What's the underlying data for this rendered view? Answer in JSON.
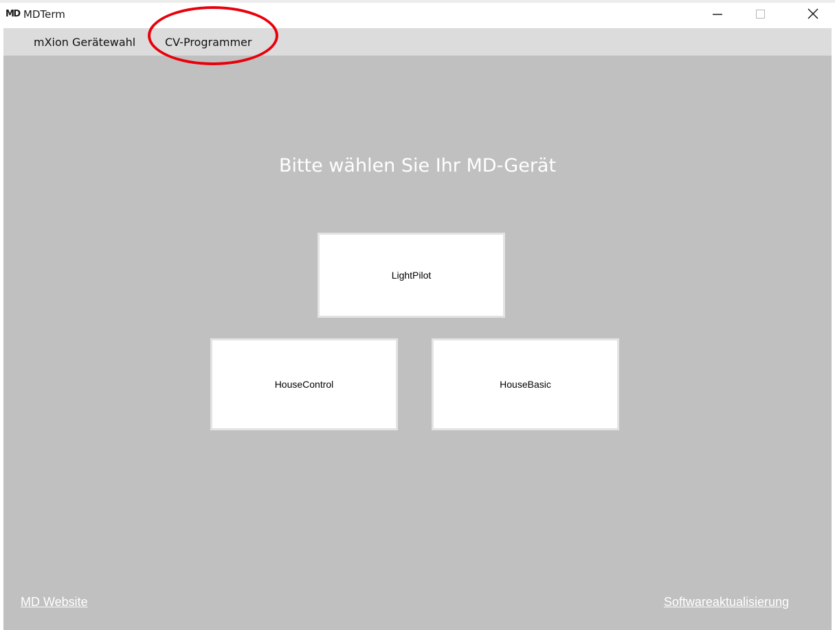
{
  "window": {
    "logo": "MD",
    "title": "MDTerm"
  },
  "menu": {
    "items": [
      {
        "label": "mXion Gerätewahl"
      },
      {
        "label": "CV-Programmer"
      }
    ]
  },
  "main": {
    "heading": "Bitte wählen Sie Ihr MD-Gerät",
    "devices": [
      {
        "label": "LightPilot"
      },
      {
        "label": "HouseControl"
      },
      {
        "label": "HouseBasic"
      }
    ]
  },
  "footer": {
    "website_link": "MD Website",
    "update_link": "Softwareaktualisierung"
  },
  "colors": {
    "client_background": "#c0c0c0",
    "menubar_background": "#dcdcdc",
    "highlight_annotation": "#e8000b",
    "button_background": "#ffffff"
  },
  "icons": [
    "minimize-icon",
    "maximize-icon",
    "close-icon"
  ]
}
